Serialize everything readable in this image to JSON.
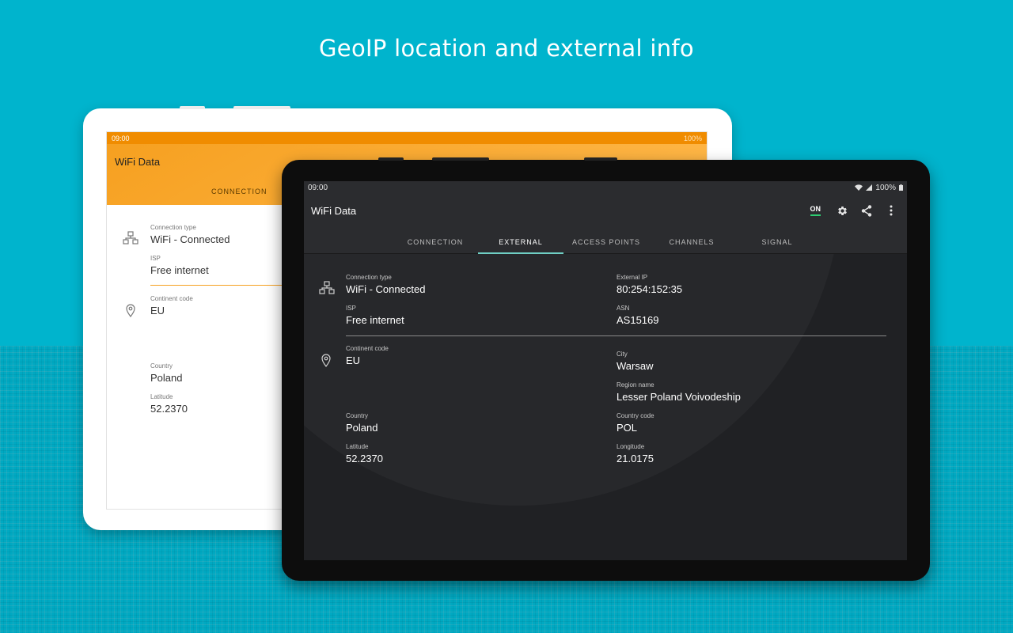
{
  "headline": "GeoIP location and external info",
  "back_device": {
    "status": {
      "time": "09:00",
      "battery": "100%"
    },
    "app_title": "WiFi Data",
    "tab": "CONNECTION",
    "connection": {
      "type_label": "Connection type",
      "type_value": "WiFi - Connected",
      "isp_label": "ISP",
      "isp_value": "Free internet"
    },
    "location": {
      "continent_label": "Continent code",
      "continent_value": "EU",
      "country_label": "Country",
      "country_value": "Poland",
      "latitude_label": "Latitude",
      "latitude_value": "52.2370"
    }
  },
  "front_device": {
    "status": {
      "time": "09:00",
      "battery": "100%"
    },
    "app_title": "WiFi Data",
    "on_toggle": "ON",
    "icons": {
      "settings": "gear-icon",
      "share": "share-icon",
      "more": "more-vert-icon"
    },
    "tabs": [
      {
        "label": "CONNECTION",
        "active": false
      },
      {
        "label": "EXTERNAL",
        "active": true
      },
      {
        "label": "ACCESS POINTS",
        "active": false
      },
      {
        "label": "CHANNELS",
        "active": false
      },
      {
        "label": "SIGNAL",
        "active": false
      }
    ],
    "connection": {
      "type_label": "Connection type",
      "type_value": "WiFi - Connected",
      "isp_label": "ISP",
      "isp_value": "Free internet",
      "external_ip_label": "External IP",
      "external_ip_value": "80:254:152:35",
      "asn_label": "ASN",
      "asn_value": "AS15169"
    },
    "location": {
      "continent_label": "Continent code",
      "continent_value": "EU",
      "city_label": "City",
      "city_value": "Warsaw",
      "region_label": "Region name",
      "region_value": "Lesser Poland Voivodeship",
      "country_label": "Country",
      "country_value": "Poland",
      "country_code_label": "Country code",
      "country_code_value": "POL",
      "latitude_label": "Latitude",
      "latitude_value": "52.2370",
      "longitude_label": "Longitude",
      "longitude_value": "21.0175"
    }
  },
  "colors": {
    "background": "#00b4cd",
    "orange_accent": "#f6a020",
    "dark_surface": "#202124",
    "tab_indicator": "#6fcfc4",
    "toggle_on": "#2ecc71"
  }
}
